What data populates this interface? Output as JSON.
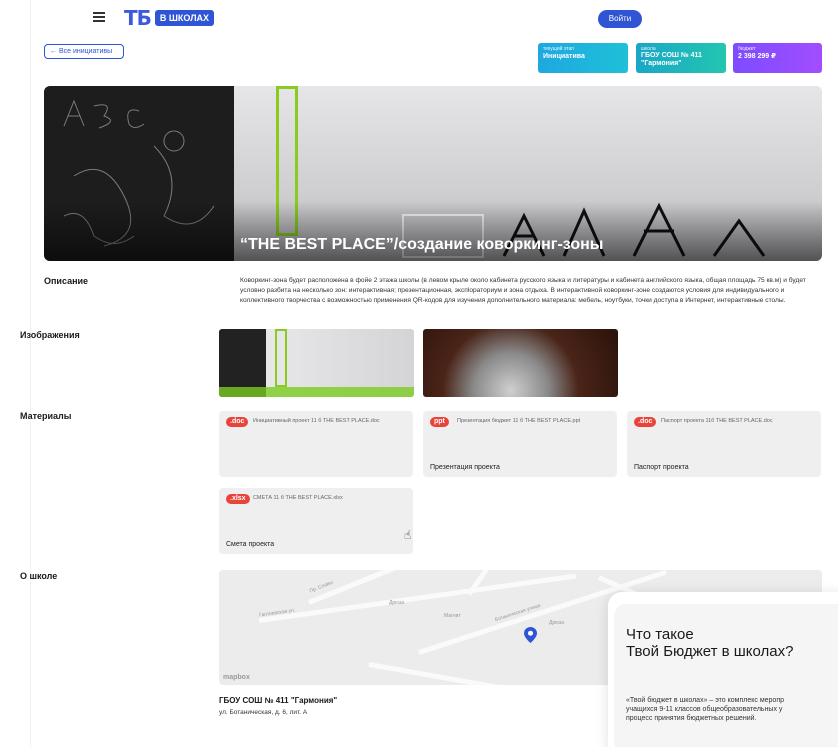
{
  "header": {
    "logo_mark": "ТБ",
    "logo_badge": "В ШКОЛАХ",
    "login_label": "Войти"
  },
  "back_label": "← Все инициативы",
  "info": {
    "stage_label": "текущий этап",
    "stage_value": "Инициатива",
    "school_label": "школа",
    "school_value": "ГБОУ СОШ № 411 \"Гармония\"",
    "budget_label": "бюджет",
    "budget_value": "2 398 299 ₽"
  },
  "hero_title": "“THE BEST PLACE”/создание коворкинг-зоны",
  "sections": {
    "description": "Описание",
    "images": "Изображения",
    "materials": "Материалы",
    "about_school": "О школе"
  },
  "description_text": "Коворкинг-зона будет расположена в фойе 2 этажа школы (в левом крыле около кабинета русского языка и литературы и кабинета английского языка, общая площадь 75 кв.м) и будет условно разбита на несколько зон: интерактивная; презентационная, экспloраториум и зона отдыха. В интерактивной коворкинг-зоне создаются условия для индивидуального и коллективного творчества с возможностью применения QR-кодов для изучения дополнительного материала: мебель, ноутбуки, точки доступа в Интернет, интерактивные столы.",
  "materials": [
    {
      "ext": ".doc",
      "file": "Инициативный проект 11 б THE BEST PLACE.doc",
      "title": ""
    },
    {
      "ext": "ppt",
      "file": "Презентация бюджет 11 б THE BEST PLACE.ppt",
      "title": "Презентация проекта"
    },
    {
      "ext": ".doc",
      "file": "Паспорт проекта 11б THE BEST PLACE.doc",
      "title": "Паспорт проекта"
    },
    {
      "ext": ".xlsx",
      "file": "СМЕТА 11 б THE BEST PLACE.xlsx",
      "title": "Смета проекта"
    }
  ],
  "map": {
    "streets": [
      "Пр. Славы",
      "Гаглоевская ул.",
      "Дрюза",
      "Ботаническая улица",
      "Дрюза",
      "Магнит"
    ],
    "attribution": "mapbox"
  },
  "school": {
    "name": "ГБОУ СОШ № 411 \"Гармония\"",
    "address": "ул. Ботаническая, д. 6, лит. А"
  },
  "popup": {
    "title_line1": "Что такое",
    "title_line2": "Твой Бюджет в школах?",
    "text_line1": "«Твой бюджет в школах» – это комплекс меропр",
    "text_line2": "учащихся 9-11 классов общеобразовательных у",
    "text_line3": "процесс принятия бюджетных решений."
  },
  "colors": {
    "brand": "#2f55d4",
    "doc_badge": "#e8443a",
    "map_pin": "#2f55d4"
  }
}
